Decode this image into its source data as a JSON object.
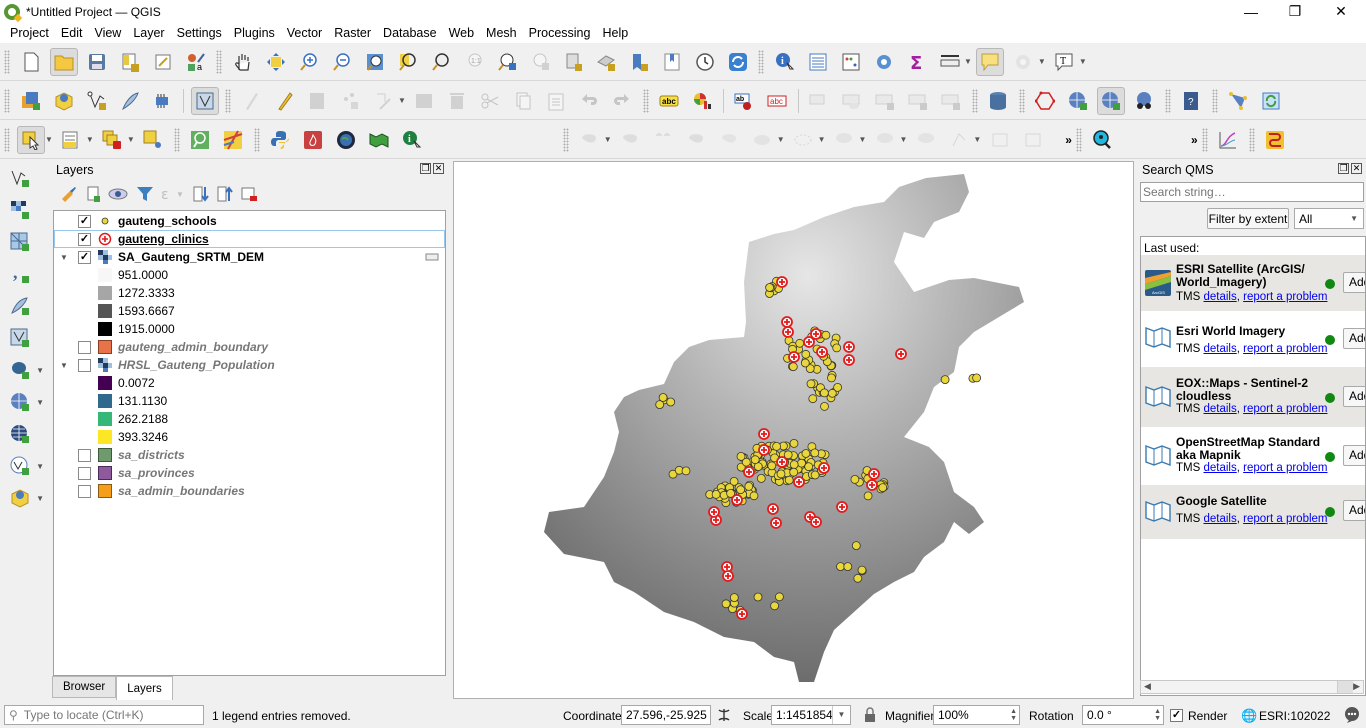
{
  "window": {
    "title": "*Untitled Project — QGIS",
    "minimize": "—",
    "restore": "❐",
    "close": "✕"
  },
  "menu": [
    "Project",
    "Edit",
    "View",
    "Layer",
    "Settings",
    "Plugins",
    "Vector",
    "Raster",
    "Database",
    "Web",
    "Mesh",
    "Processing",
    "Help"
  ],
  "toolbar_overflow": "»",
  "layers_panel": {
    "title": "Layers",
    "layers": [
      {
        "name": "gauteng_schools",
        "checked": true,
        "symbol": "yellow-point",
        "color": "#e8d63a"
      },
      {
        "name": "gauteng_clinics",
        "checked": true,
        "symbol": "red-cross",
        "color": "#e31a1c"
      },
      {
        "name": "SA_Gauteng_SRTM_DEM",
        "checked": true,
        "symbol": "raster",
        "expanded": true,
        "legend": [
          {
            "value": "951.0000",
            "color": "#f7f7f7"
          },
          {
            "value": "1272.3333",
            "color": "#a6a6a6"
          },
          {
            "value": "1593.6667",
            "color": "#555555"
          },
          {
            "value": "1915.0000",
            "color": "#000000"
          }
        ]
      },
      {
        "name": "gauteng_admin_boundary",
        "checked": false,
        "symbol": "fill",
        "color": "#e8734a"
      },
      {
        "name": "HRSL_Gauteng_Population",
        "checked": false,
        "symbol": "raster",
        "expanded": true,
        "legend": [
          {
            "value": "0.0072",
            "color": "#440154"
          },
          {
            "value": "131.1130",
            "color": "#31688e"
          },
          {
            "value": "262.2188",
            "color": "#35b779"
          },
          {
            "value": "393.3246",
            "color": "#fde725"
          }
        ]
      },
      {
        "name": "sa_districts",
        "checked": false,
        "symbol": "fill",
        "color": "#6e9a6e"
      },
      {
        "name": "sa_provinces",
        "checked": false,
        "symbol": "fill",
        "color": "#8e5a9c"
      },
      {
        "name": "sa_admin_boundaries",
        "checked": false,
        "symbol": "fill",
        "color": "#f59e1a"
      }
    ],
    "tabs": [
      "Browser",
      "Layers"
    ],
    "active_tab": "Layers"
  },
  "qms_panel": {
    "title": "Search QMS",
    "search_placeholder": "Search string…",
    "filter_button": "Filter by extent",
    "filter_select": "All",
    "last_used_label": "Last used:",
    "services": [
      {
        "name": "ESRI Satellite (ArcGIS/ World_Imagery)",
        "type": "TMS",
        "details": "details",
        "report": "report a problem",
        "add": "Add",
        "status": "ok"
      },
      {
        "name": "Esri World Imagery",
        "type": "TMS",
        "details": "details",
        "report": "report a problem",
        "add": "Add",
        "status": "ok"
      },
      {
        "name": "EOX::Maps - Sentinel-2 cloudless",
        "type": "TMS",
        "details": "details",
        "report": "report a problem",
        "add": "Add",
        "status": "ok"
      },
      {
        "name": "OpenStreetMap Standard aka Mapnik",
        "type": "TMS",
        "details": "details",
        "report": "report a problem",
        "add": "Add",
        "status": "ok"
      },
      {
        "name": "Google Satellite",
        "type": "TMS",
        "details": "details",
        "report": "report a problem",
        "add": "Add",
        "status": "ok"
      }
    ]
  },
  "statusbar": {
    "locator_placeholder": "Type to locate (Ctrl+K)",
    "message": "1 legend entries removed.",
    "coordinate_label": "Coordinate",
    "coordinate": "27.596,-25.925",
    "scale_label": "Scale",
    "scale": "1:1451854",
    "magnifier_label": "Magnifier",
    "magnifier": "100%",
    "rotation_label": "Rotation",
    "rotation": "0.0 °",
    "render_label": "Render",
    "render_checked": true,
    "crs": "ESRI:102022"
  },
  "colors": {
    "school": "#e8d63a",
    "clinic": "#e31a1c",
    "qms_ok": "#118811"
  }
}
